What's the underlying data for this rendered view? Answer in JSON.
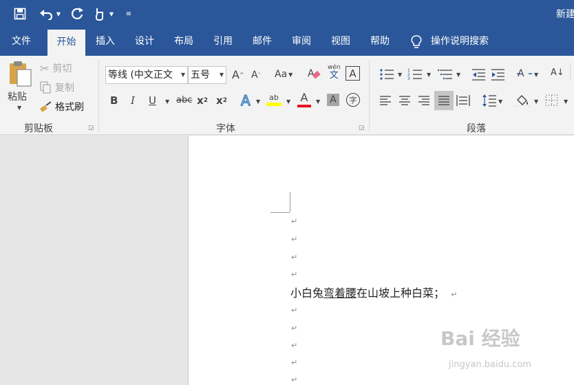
{
  "quick_access": {
    "title": "新建",
    "icons": [
      "save-icon",
      "undo-icon",
      "redo-icon",
      "touch-mode-icon",
      "customize-qat-icon"
    ]
  },
  "tabs": [
    {
      "label": "文件"
    },
    {
      "label": "开始"
    },
    {
      "label": "插入"
    },
    {
      "label": "设计"
    },
    {
      "label": "布局"
    },
    {
      "label": "引用"
    },
    {
      "label": "邮件"
    },
    {
      "label": "审阅"
    },
    {
      "label": "视图"
    },
    {
      "label": "帮助"
    }
  ],
  "active_tab": "开始",
  "tell_me": "操作说明搜索",
  "clipboard": {
    "paste": "粘贴",
    "cut": "剪切",
    "copy": "复制",
    "format_painter": "格式刷",
    "group_label": "剪贴板"
  },
  "font": {
    "font_name": "等线 (中文正文",
    "font_size": "五号",
    "grow": "A",
    "shrink": "A",
    "change_case": "Aa",
    "phonetic_top": "wén",
    "phonetic_bottom": "文",
    "char_border": "A",
    "bold": "B",
    "italic": "I",
    "underline": "U",
    "strike": "abc",
    "subscript": "x",
    "subscript_small": "2",
    "superscript": "x",
    "superscript_small": "2",
    "text_effect": "A",
    "highlight": "ab",
    "font_color": "A",
    "char_shading": "A",
    "enclose": "字",
    "group_label": "字体"
  },
  "paragraph": {
    "group_label": "段落",
    "sort": "A↓"
  },
  "colors": {
    "brand": "#2b579a",
    "highlight": "#ffff00",
    "font_color": "#e81123",
    "ribbon": "#f3f3f3"
  },
  "document": {
    "line_text_before": "小白兔",
    "line_text_underlined": "弯着腰",
    "line_text_after": "在山坡上种白菜；",
    "paragraph_mark": "↵"
  },
  "watermark": {
    "text": "Bai 经验",
    "url": "jingyan.baidu.com"
  }
}
